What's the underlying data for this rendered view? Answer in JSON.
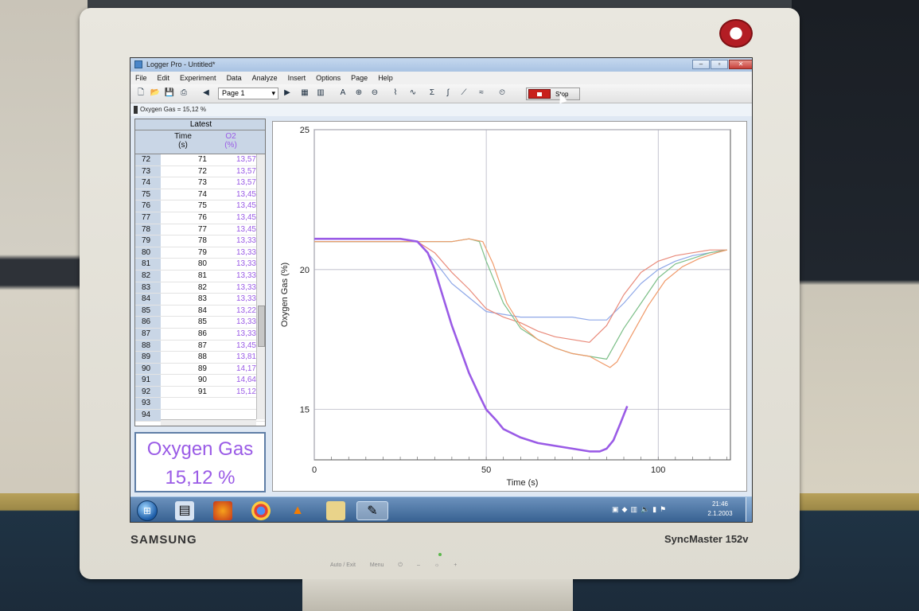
{
  "monitor": {
    "brand": "SAMSUNG",
    "model": "SyncMaster 152v",
    "controls": [
      "Auto / Exit",
      "Menu",
      "⏻",
      "–",
      "☼",
      "+"
    ]
  },
  "window": {
    "title": "Logger Pro - Untitled*"
  },
  "menu": [
    "File",
    "Edit",
    "Experiment",
    "Data",
    "Analyze",
    "Insert",
    "Options",
    "Page",
    "Help"
  ],
  "toolbar": {
    "page_select": "Page 1",
    "stop_label": "Stop"
  },
  "status": {
    "sensor_reading": "Oxygen Gas = 15,12 %"
  },
  "table": {
    "group_header": "Latest",
    "col_time": "Time",
    "col_time_unit": "(s)",
    "col_o2": "O2",
    "col_o2_unit": "(%)",
    "rows": [
      {
        "n": "72",
        "t": "71",
        "o": "13,57"
      },
      {
        "n": "73",
        "t": "72",
        "o": "13,57"
      },
      {
        "n": "74",
        "t": "73",
        "o": "13,57"
      },
      {
        "n": "75",
        "t": "74",
        "o": "13,45"
      },
      {
        "n": "76",
        "t": "75",
        "o": "13,45"
      },
      {
        "n": "77",
        "t": "76",
        "o": "13,45"
      },
      {
        "n": "78",
        "t": "77",
        "o": "13,45"
      },
      {
        "n": "79",
        "t": "78",
        "o": "13,33"
      },
      {
        "n": "80",
        "t": "79",
        "o": "13,33"
      },
      {
        "n": "81",
        "t": "80",
        "o": "13,33"
      },
      {
        "n": "82",
        "t": "81",
        "o": "13,33"
      },
      {
        "n": "83",
        "t": "82",
        "o": "13,33"
      },
      {
        "n": "84",
        "t": "83",
        "o": "13,33"
      },
      {
        "n": "85",
        "t": "84",
        "o": "13,22"
      },
      {
        "n": "86",
        "t": "85",
        "o": "13,33"
      },
      {
        "n": "87",
        "t": "86",
        "o": "13,33"
      },
      {
        "n": "88",
        "t": "87",
        "o": "13,45"
      },
      {
        "n": "89",
        "t": "88",
        "o": "13,81"
      },
      {
        "n": "90",
        "t": "89",
        "o": "14,17"
      },
      {
        "n": "91",
        "t": "90",
        "o": "14,64"
      },
      {
        "n": "92",
        "t": "91",
        "o": "15,12"
      },
      {
        "n": "93",
        "t": "",
        "o": ""
      },
      {
        "n": "94",
        "t": "",
        "o": ""
      }
    ]
  },
  "meter": {
    "label": "Oxygen Gas",
    "value": "15,12 %"
  },
  "chart_data": {
    "type": "line",
    "title": "",
    "xlabel": "Time (s)",
    "ylabel": "Oxygen Gas (%)",
    "xlim": [
      0,
      121
    ],
    "ylim": [
      13.2,
      25
    ],
    "xticks": [
      0,
      50,
      100
    ],
    "yticks": [
      15,
      20,
      25
    ],
    "grid": true,
    "series": [
      {
        "color": "#9a5be6",
        "bold": true,
        "x": [
          0,
          5,
          10,
          15,
          20,
          25,
          30,
          33,
          35,
          37,
          40,
          45,
          48,
          50,
          53,
          55,
          60,
          65,
          70,
          75,
          80,
          83,
          85,
          87,
          89,
          91
        ],
        "y": [
          21.1,
          21.1,
          21.1,
          21.1,
          21.1,
          21.1,
          21.0,
          20.6,
          20.0,
          19.2,
          18.0,
          16.3,
          15.5,
          15.0,
          14.6,
          14.3,
          14.0,
          13.8,
          13.7,
          13.6,
          13.5,
          13.5,
          13.6,
          13.9,
          14.5,
          15.12
        ]
      },
      {
        "color": "#8fa8e8",
        "x": [
          0,
          10,
          20,
          30,
          35,
          40,
          45,
          50,
          55,
          60,
          65,
          70,
          75,
          80,
          85,
          90,
          95,
          100,
          105,
          110,
          115,
          120
        ],
        "y": [
          21.0,
          21.0,
          21.0,
          21.0,
          20.3,
          19.5,
          19.0,
          18.5,
          18.4,
          18.3,
          18.3,
          18.3,
          18.3,
          18.2,
          18.2,
          18.8,
          19.5,
          20.0,
          20.3,
          20.5,
          20.6,
          20.7
        ]
      },
      {
        "color": "#e98a7a",
        "x": [
          0,
          10,
          20,
          30,
          35,
          40,
          45,
          50,
          55,
          60,
          65,
          70,
          75,
          80,
          85,
          90,
          95,
          100,
          105,
          110,
          115,
          120
        ],
        "y": [
          21.0,
          21.0,
          21.0,
          21.0,
          20.6,
          19.9,
          19.3,
          18.6,
          18.3,
          18.1,
          17.8,
          17.6,
          17.5,
          17.4,
          18.0,
          19.1,
          19.9,
          20.3,
          20.5,
          20.6,
          20.7,
          20.7
        ]
      },
      {
        "color": "#7cbf88",
        "x": [
          0,
          10,
          20,
          30,
          40,
          45,
          48,
          50,
          55,
          60,
          65,
          70,
          75,
          80,
          85,
          90,
          95,
          100,
          105,
          110,
          115,
          120
        ],
        "y": [
          21.0,
          21.0,
          21.0,
          21.0,
          21.0,
          21.1,
          21.0,
          20.3,
          18.8,
          17.9,
          17.5,
          17.2,
          17.0,
          16.9,
          16.8,
          17.9,
          18.8,
          19.7,
          20.2,
          20.4,
          20.6,
          20.7
        ]
      },
      {
        "color": "#f09a6a",
        "x": [
          0,
          10,
          20,
          30,
          40,
          45,
          49,
          52,
          56,
          60,
          65,
          70,
          75,
          80,
          86,
          88,
          92,
          97,
          102,
          107,
          112,
          117,
          120
        ],
        "y": [
          21.0,
          21.0,
          21.0,
          21.0,
          21.0,
          21.1,
          21.0,
          20.2,
          18.8,
          18.0,
          17.5,
          17.2,
          17.0,
          16.9,
          16.5,
          16.7,
          17.6,
          18.7,
          19.6,
          20.1,
          20.4,
          20.6,
          20.7
        ]
      }
    ]
  },
  "taskbar": {
    "clock_time": "21:46",
    "clock_date": "2.1.2003"
  },
  "colors": {
    "o2": "#9a5be6",
    "accent": "#c8201c"
  }
}
